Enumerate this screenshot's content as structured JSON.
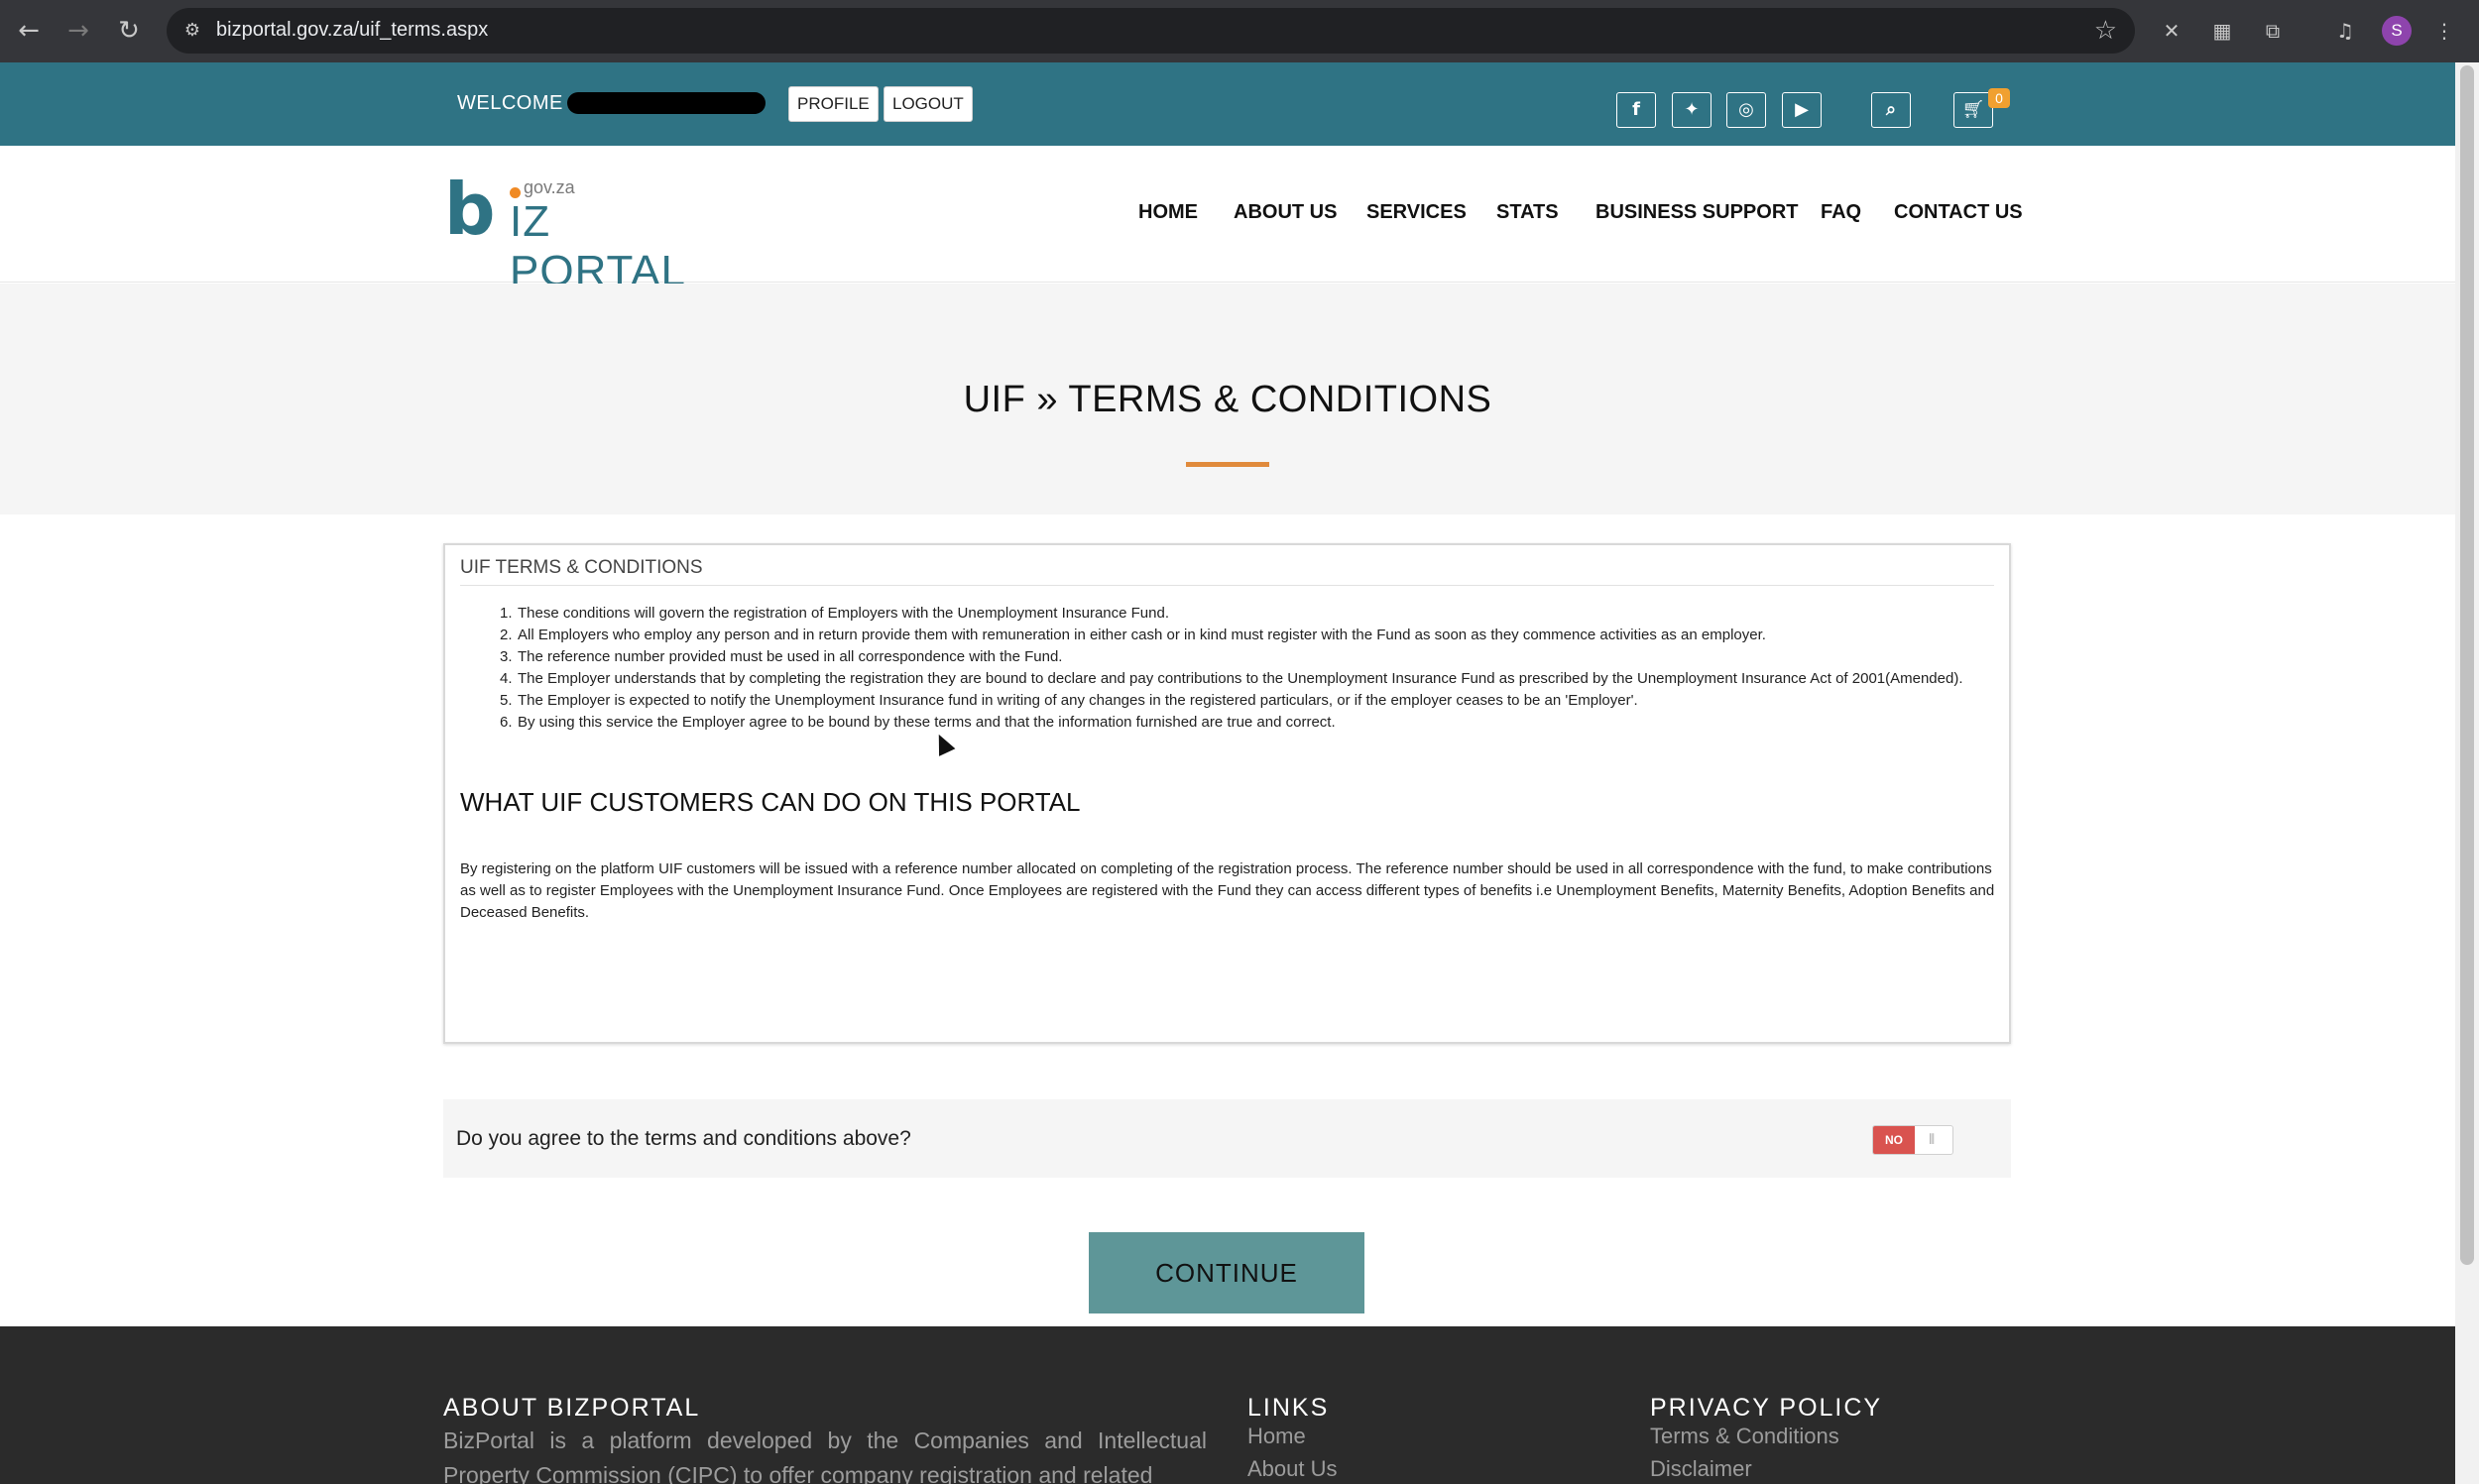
{
  "browser": {
    "url": "bizportal.gov.za/uif_terms.aspx",
    "avatar_letter": "S"
  },
  "topbar": {
    "welcome": "WELCOME",
    "profile_label": "PROFILE",
    "logout_label": "LOGOUT",
    "social_icons": [
      "facebook-icon",
      "twitter-icon",
      "instagram-icon",
      "youtube-icon"
    ],
    "cart_count": "0",
    "bg_color": "#2f7384"
  },
  "header": {
    "logo": {
      "gov": "gov.za",
      "text": "IZ PORTAL"
    },
    "nav": [
      "HOME",
      "ABOUT US",
      "SERVICES",
      "STATS",
      "BUSINESS SUPPORT",
      "FAQ",
      "CONTACT US"
    ]
  },
  "hero": {
    "title": "UIF » TERMS & CONDITIONS",
    "accent_color": "#e08a3c"
  },
  "terms": {
    "heading": "UIF TERMS & CONDITIONS",
    "items": [
      "These conditions will govern the registration of Employers with the Unemployment Insurance Fund.",
      "All Employers who employ any person and in return provide them with remuneration in either cash or in kind must register with the Fund as soon as they commence activities as an employer.",
      "The reference number provided must be used in all correspondence with the Fund.",
      "The Employer understands that by completing the registration they are bound to declare and pay contributions to the Unemployment Insurance Fund as prescribed by the Unemployment Insurance Act of 2001(Amended).",
      "The Employer is expected to notify the Unemployment Insurance fund in writing of any changes in the registered particulars, or if the employer ceases to be an 'Employer'.",
      "By using this service the Employer agree to be bound by these terms and that the information furnished are true and correct."
    ],
    "numbers": [
      "1.",
      "2.",
      "3.",
      "4.",
      "5.",
      "6."
    ],
    "section_heading": "WHAT UIF CUSTOMERS CAN DO ON THIS PORTAL",
    "section_text": "By registering on the platform UIF customers will be issued with a reference number allocated on completing of the registration process. The reference number should be used in all correspondence with the fund, to make contributions as well as to register Employees with the Unemployment Insurance Fund. Once Employees are registered with the Fund they can access different types of benefits i.e Unemployment Benefits, Maternity Benefits, Adoption Benefits and Deceased Benefits."
  },
  "agreement": {
    "question": "Do you agree to the terms and conditions above?",
    "toggle_label": "NO",
    "toggle_color": "#d9534f"
  },
  "continue_label": "CONTINUE",
  "footer": {
    "about_heading": "ABOUT BIZPORTAL",
    "about_text": "BizPortal is a platform developed by the Companies and Intellectual Property Commission (CIPC) to offer company registration and related",
    "links_heading": "LINKS",
    "links": [
      "Home",
      "About Us"
    ],
    "privacy_heading": "PRIVACY POLICY",
    "privacy_links": [
      "Terms & Conditions",
      "Disclaimer"
    ]
  }
}
